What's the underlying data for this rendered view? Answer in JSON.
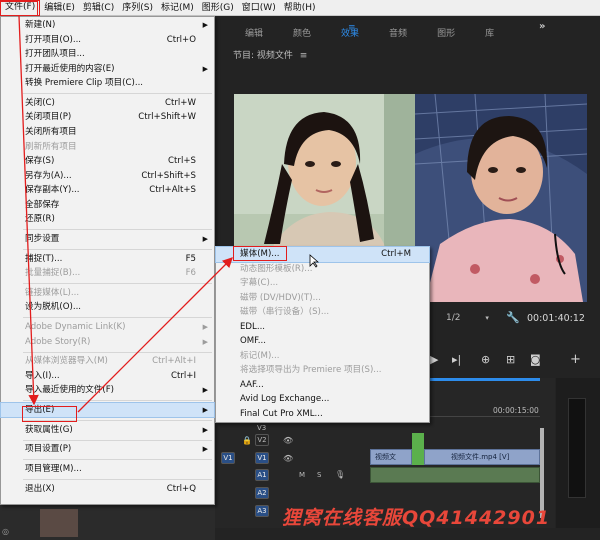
{
  "menubar": {
    "items": [
      "文件(F)",
      "编辑(E)",
      "剪辑(C)",
      "序列(S)",
      "标记(M)",
      "图形(G)",
      "窗口(W)",
      "帮助(H)"
    ],
    "active_index": 0
  },
  "workspace": {
    "tabs": [
      "编辑",
      "颜色",
      "效果",
      "音频",
      "图形",
      "库"
    ],
    "selected_tab": "效果",
    "program_monitor_title": "节目: 视频文件",
    "resolution": "1/2",
    "timecode": "00:01:40:12",
    "ruler_time": "00:00:15:00",
    "tracks": {
      "video": [
        "V3",
        "V2",
        "V1"
      ],
      "audio": [
        "A1",
        "A2",
        "A3"
      ],
      "v1_source": "V1",
      "track_letters": [
        "M",
        "S"
      ]
    },
    "clip_labels": [
      "视频文",
      "视频文件.mp4 [V]"
    ]
  },
  "file_menu": {
    "items": [
      {
        "label": "新建(N)",
        "shortcut": "",
        "submenu": true,
        "disabled": false
      },
      {
        "label": "打开项目(O)...",
        "shortcut": "Ctrl+O",
        "submenu": false,
        "disabled": false
      },
      {
        "label": "打开团队项目...",
        "shortcut": "",
        "submenu": false,
        "disabled": false
      },
      {
        "label": "打开最近使用的内容(E)",
        "shortcut": "",
        "submenu": true,
        "disabled": false
      },
      {
        "label": "转换 Premiere Clip 项目(C)...",
        "shortcut": "",
        "submenu": false,
        "disabled": false
      },
      {
        "sep": true
      },
      {
        "label": "关闭(C)",
        "shortcut": "Ctrl+W",
        "submenu": false,
        "disabled": false
      },
      {
        "label": "关闭项目(P)",
        "shortcut": "Ctrl+Shift+W",
        "submenu": false,
        "disabled": false
      },
      {
        "label": "关闭所有项目",
        "shortcut": "",
        "submenu": false,
        "disabled": false
      },
      {
        "label": "刷新所有项目",
        "shortcut": "",
        "submenu": false,
        "disabled": true
      },
      {
        "label": "保存(S)",
        "shortcut": "Ctrl+S",
        "submenu": false,
        "disabled": false
      },
      {
        "label": "另存为(A)...",
        "shortcut": "Ctrl+Shift+S",
        "submenu": false,
        "disabled": false
      },
      {
        "label": "保存副本(Y)...",
        "shortcut": "Ctrl+Alt+S",
        "submenu": false,
        "disabled": false
      },
      {
        "label": "全部保存",
        "shortcut": "",
        "submenu": false,
        "disabled": false
      },
      {
        "label": "还原(R)",
        "shortcut": "",
        "submenu": false,
        "disabled": false
      },
      {
        "sep": true
      },
      {
        "label": "同步设置",
        "shortcut": "",
        "submenu": true,
        "disabled": false
      },
      {
        "sep": true
      },
      {
        "label": "捕捉(T)...",
        "shortcut": "F5",
        "submenu": false,
        "disabled": false
      },
      {
        "label": "批量捕捉(B)...",
        "shortcut": "F6",
        "submenu": false,
        "disabled": true
      },
      {
        "sep": true
      },
      {
        "label": "链接媒体(L)...",
        "shortcut": "",
        "submenu": false,
        "disabled": true
      },
      {
        "label": "设为脱机(O)...",
        "shortcut": "",
        "submenu": false,
        "disabled": false
      },
      {
        "sep": true
      },
      {
        "label": "Adobe Dynamic Link(K)",
        "shortcut": "",
        "submenu": true,
        "disabled": true
      },
      {
        "label": "Adobe Story(R)",
        "shortcut": "",
        "submenu": true,
        "disabled": true
      },
      {
        "sep": true
      },
      {
        "label": "从媒体浏览器导入(M)",
        "shortcut": "Ctrl+Alt+I",
        "submenu": false,
        "disabled": true
      },
      {
        "label": "导入(I)...",
        "shortcut": "Ctrl+I",
        "submenu": false,
        "disabled": false
      },
      {
        "label": "导入最近使用的文件(F)",
        "shortcut": "",
        "submenu": true,
        "disabled": false
      },
      {
        "sep": true
      },
      {
        "label": "导出(E)",
        "shortcut": "",
        "submenu": true,
        "disabled": false,
        "highlighted": true
      },
      {
        "sep": true
      },
      {
        "label": "获取属性(G)",
        "shortcut": "",
        "submenu": true,
        "disabled": false
      },
      {
        "sep": true
      },
      {
        "label": "项目设置(P)",
        "shortcut": "",
        "submenu": true,
        "disabled": false
      },
      {
        "sep": true
      },
      {
        "label": "项目管理(M)...",
        "shortcut": "",
        "submenu": false,
        "disabled": false
      },
      {
        "sep": true
      },
      {
        "label": "退出(X)",
        "shortcut": "Ctrl+Q",
        "submenu": false,
        "disabled": false
      }
    ]
  },
  "export_submenu": {
    "items": [
      {
        "label": "媒体(M)...",
        "shortcut": "Ctrl+M",
        "disabled": false,
        "highlighted": true
      },
      {
        "label": "动态图形模板(R)...",
        "shortcut": "",
        "disabled": true
      },
      {
        "label": "字幕(C)...",
        "shortcut": "",
        "disabled": true
      },
      {
        "label": "磁带 (DV/HDV)(T)...",
        "shortcut": "",
        "disabled": true
      },
      {
        "label": "磁带（串行设备）(S)...",
        "shortcut": "",
        "disabled": true
      },
      {
        "label": "EDL...",
        "shortcut": "",
        "disabled": false
      },
      {
        "label": "OMF...",
        "shortcut": "",
        "disabled": false
      },
      {
        "label": "标记(M)...",
        "shortcut": "",
        "disabled": true
      },
      {
        "label": "将选择项导出为 Premiere 项目(S)...",
        "shortcut": "",
        "disabled": true
      },
      {
        "label": "AAF...",
        "shortcut": "",
        "disabled": false
      },
      {
        "label": "Avid Log Exchange...",
        "shortcut": "",
        "disabled": false
      },
      {
        "label": "Final Cut Pro XML...",
        "shortcut": "",
        "disabled": false
      }
    ]
  },
  "watermark": "狸窝在线客服QQ41442901",
  "colors": {
    "annotation": "#e21d1d",
    "selected_tab": "#2d8ceb",
    "watermark": "#e8473a"
  }
}
